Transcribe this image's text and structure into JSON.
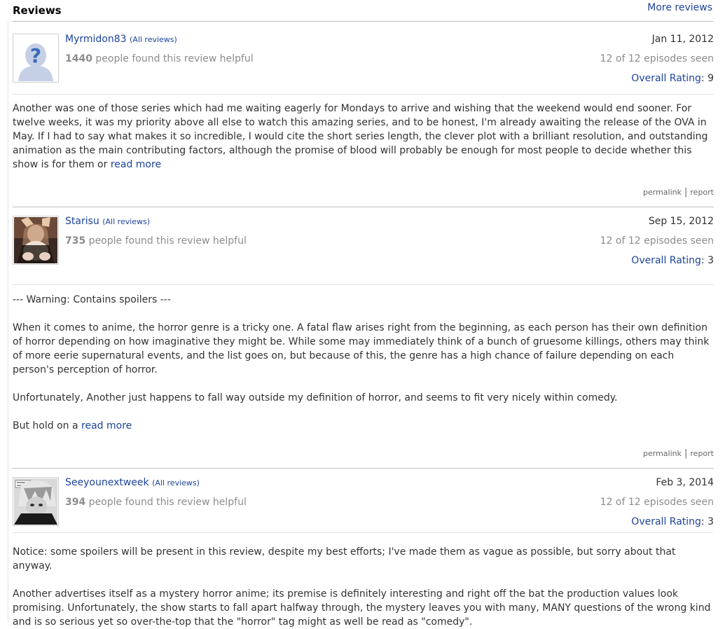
{
  "header": {
    "title": "Reviews",
    "more_link": "More reviews"
  },
  "reviews": [
    {
      "username": "Myrmidon83",
      "all_reviews": "(All reviews)",
      "helpful_count": "1440",
      "helpful_text": " people found this review helpful",
      "date": "Jan 11, 2012",
      "episodes_seen": "12 of 12 episodes seen",
      "rating_label": "Overall Rating",
      "rating_value": ": 9",
      "paragraphs": [
        "Another was one of those series which had me waiting eagerly for Mondays to arrive and wishing that the weekend would end sooner. For twelve weeks, it was my priority above all else to watch this amazing series, and to be honest, I'm already awaiting the release of the OVA in May. If I had to say what makes it so incredible, I would cite the short series length, the clever plot with a brilliant resolution, and outstanding animation as the main contributing factors, although the promise of blood will probably be enough for most people to decide whether this show is for them or"
      ],
      "read_more": "read more",
      "permalink": "permalink",
      "report": "report"
    },
    {
      "username": "Starisu",
      "all_reviews": "(All reviews)",
      "helpful_count": "735",
      "helpful_text": " people found this review helpful",
      "date": "Sep 15, 2012",
      "episodes_seen": "12 of 12 episodes seen",
      "rating_label": "Overall Rating",
      "rating_value": ": 3",
      "paragraphs": [
        "--- Warning: Contains spoilers ---",
        "When it comes to anime, the horror genre is a tricky one. A fatal flaw arises right from the beginning, as each person has their own definition of horror depending on how imaginative they might be. While some may immediately think of a bunch of gruesome killings, others may think of more eerie supernatural events, and the list goes on, but because of this, the genre has a high chance of failure depending on each person's perception of horror.",
        "Unfortunately, Another just happens to fall way outside my definition of horror, and seems to fit very nicely within comedy.",
        "But hold on a"
      ],
      "read_more": "read more",
      "permalink": "permalink",
      "report": "report"
    },
    {
      "username": "Seeyounextweek",
      "all_reviews": "(All reviews)",
      "helpful_count": "394",
      "helpful_text": " people found this review helpful",
      "date": "Feb 3, 2014",
      "episodes_seen": "12 of 12 episodes seen",
      "rating_label": "Overall Rating",
      "rating_value": ": 3",
      "paragraphs": [
        "Notice: some spoilers will be present in this review, despite my best efforts; I've made them as vague as possible, but sorry about that anyway.",
        "Another advertises itself as a mystery horror anime; its premise is definitely interesting and right off the bat the production values look promising. Unfortunately, the show starts to fall apart halfway through, the mystery leaves you with many, MANY questions of the wrong kind and is so serious yet so over-the-top that the \"horror\" tag might as well be read as \"comedy\"."
      ]
    }
  ]
}
